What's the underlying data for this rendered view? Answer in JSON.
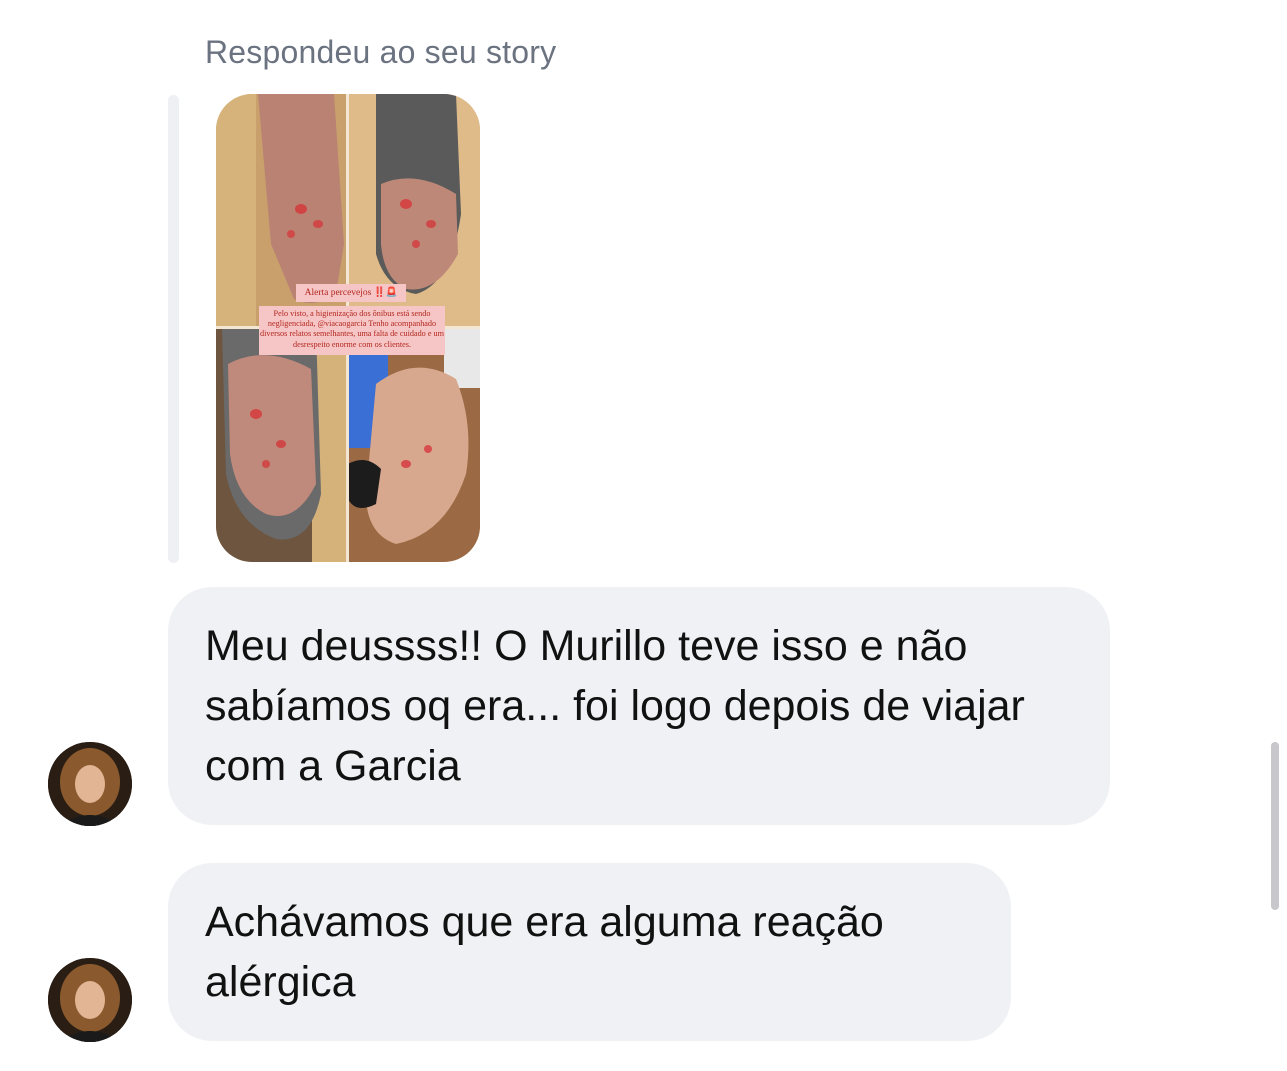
{
  "reply_header": "Respondeu ao seu story",
  "story": {
    "title": "Alerta percevejos ‼️🚨",
    "body": "Pelo visto, a higienização dos ônibus está sendo negligenciada, @viacaogarcia Tenho acompanhado diversos relatos semelhantes, uma falta de cuidado e um desrespeito enorme com os clientes."
  },
  "messages": [
    {
      "text": "Meu deussss!! O Murillo teve isso e não sabíamos oq era... foi logo depois de viajar com a Garcia"
    },
    {
      "text": "Achávamos que era alguma reação alérgica"
    }
  ]
}
